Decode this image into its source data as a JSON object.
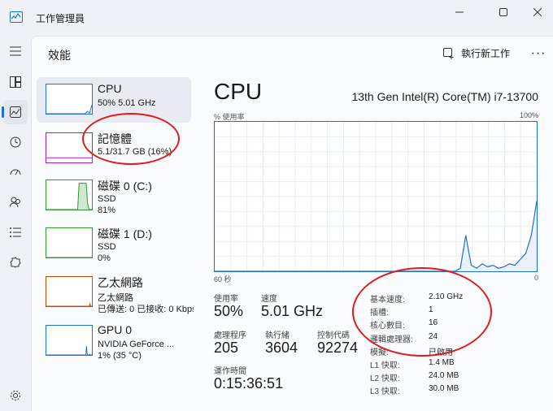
{
  "app": {
    "title": "工作管理員"
  },
  "window_controls": {
    "minimize": "—",
    "maximize": "☐",
    "close": "✕"
  },
  "toolbar": {
    "page_title": "效能",
    "run_task_label": "執行新工作",
    "more_label": "···"
  },
  "nav": [
    {
      "icon": "hamburger-icon"
    },
    {
      "icon": "processes-icon"
    },
    {
      "icon": "performance-icon",
      "active": true
    },
    {
      "icon": "app-history-icon"
    },
    {
      "icon": "startup-apps-icon"
    },
    {
      "icon": "users-icon"
    },
    {
      "icon": "details-icon"
    },
    {
      "icon": "services-icon"
    },
    {
      "icon": "settings-icon"
    }
  ],
  "sidebar": {
    "items": [
      {
        "title": "CPU",
        "line1": "50%  5.01 GHz",
        "line2": "",
        "color": "#1f6fd1",
        "selected": true
      },
      {
        "title": "記憶體",
        "line1": "5.1/31.7 GB (16%)",
        "line2": "",
        "color": "#a020c0"
      },
      {
        "title": "磁碟 0 (C:)",
        "line1": "SSD",
        "line2": "81%",
        "color": "#2e9a2e"
      },
      {
        "title": "磁碟 1 (D:)",
        "line1": "SSD",
        "line2": "0%",
        "color": "#2e9a2e"
      },
      {
        "title": "乙太網路",
        "line1": "乙太網路",
        "line2": "已傳送: 0 已接收: 0 Kbps",
        "color": "#c24a00"
      },
      {
        "title": "GPU 0",
        "line1": "NVIDIA GeForce ...",
        "line2": "1% (35 °C)",
        "color": "#1f6fd1"
      }
    ]
  },
  "detail": {
    "title": "CPU",
    "model": "13th Gen Intel(R) Core(TM) i7-13700",
    "graph_ylabel": "% 使用率",
    "graph_ymax_label": "100%",
    "graph_xlabel_left": "60 秒",
    "graph_xlabel_right": "0",
    "stats": {
      "utilization_label": "使用率",
      "utilization": "50%",
      "speed_label": "速度",
      "speed": "5.01 GHz",
      "processes_label": "處理程序",
      "processes": "205",
      "threads_label": "執行緒",
      "threads": "3604",
      "handles_label": "控制代碼",
      "handles": "92274",
      "uptime_label": "運作時間",
      "uptime": "0:15:36:51"
    },
    "specs": [
      {
        "label": "基本速度:",
        "value": "2.10 GHz"
      },
      {
        "label": "插槽:",
        "value": "1"
      },
      {
        "label": "核心數目:",
        "value": "16"
      },
      {
        "label": "邏輯處理器:",
        "value": "24"
      },
      {
        "label": "模擬:",
        "value": "已啟用"
      },
      {
        "label": "L1 快取:",
        "value": "1.4 MB"
      },
      {
        "label": "L2 快取:",
        "value": "24.0 MB"
      },
      {
        "label": "L3 快取:",
        "value": "30.0 MB"
      }
    ]
  },
  "cpu_history": [
    0,
    0,
    0,
    0,
    0,
    0,
    0,
    0,
    0,
    0,
    0,
    0,
    0,
    0,
    0,
    0,
    0,
    0,
    0,
    0,
    0,
    0,
    0,
    0,
    0,
    0,
    0,
    0,
    0,
    0,
    0,
    0,
    0,
    0,
    0,
    0,
    0,
    0,
    0,
    0,
    0,
    0,
    0,
    0,
    0,
    2,
    24,
    4,
    2,
    5,
    3,
    4,
    2,
    3,
    5,
    4,
    8,
    12,
    24,
    47
  ],
  "colors": {
    "accent": "#1f6fd1",
    "annotation": "#e01b1b"
  }
}
